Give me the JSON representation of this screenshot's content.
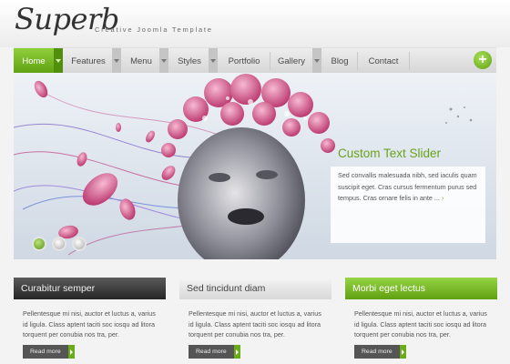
{
  "header": {
    "logo": "Superb",
    "tagline": "Creative Joomla Template"
  },
  "nav": {
    "items": [
      {
        "label": "Home",
        "has_dropdown": true,
        "active": true
      },
      {
        "label": "Features",
        "has_dropdown": true
      },
      {
        "label": "Menu",
        "has_dropdown": true
      },
      {
        "label": "Styles",
        "has_dropdown": true
      },
      {
        "label": "Portfolio",
        "has_dropdown": false
      },
      {
        "label": "Gallery",
        "has_dropdown": true
      },
      {
        "label": "Blog",
        "has_dropdown": false
      },
      {
        "label": "Contact",
        "has_dropdown": false
      }
    ],
    "plus_icon": "plus-circle-icon"
  },
  "slider": {
    "caption_title": "Custom Text Slider",
    "caption_body": "Sed convallis malesuada nibh, sed iaculis quam suscipit eget. Cras cursus fermentum purus sed tempus. Cras ornare felis in ante ...",
    "caption_more_icon": "arrow-right-icon",
    "dots": [
      {
        "active": true
      },
      {
        "active": false
      },
      {
        "active": false
      }
    ]
  },
  "columns": [
    {
      "title": "Curabitur semper",
      "style": "dark",
      "body": "Pellentesque mi nisi, auctor et luctus a, varius id ligula. Class aptent taciti soc iosqu ad litora torquent per conubia nos tra, per.",
      "read_more": "Read more"
    },
    {
      "title": "Sed tincidunt diam",
      "style": "light",
      "body": "Pellentesque mi nisi, auctor et luctus a, varius id ligula. Class aptent taciti soc iosqu ad litora torquent per conubia nos tra, per.",
      "read_more": "Read more"
    },
    {
      "title": "Morbi eget lectus",
      "style": "green",
      "body": "Pellentesque mi nisi, auctor et luctus a, varius id ligula. Class aptent taciti soc iosqu ad litora torquent per conubia nos tra, per.",
      "read_more": "Read more"
    }
  ],
  "colors": {
    "accent_green": "#6aab1a",
    "dark_header": "#2e2e2e"
  }
}
